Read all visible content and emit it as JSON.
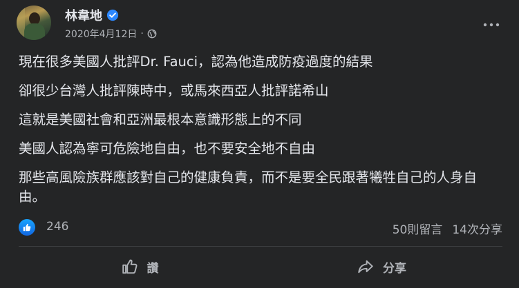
{
  "post": {
    "author": "林韋地",
    "date": "2020年4月12日",
    "separator": "·",
    "paragraphs": [
      "現在很多美國人批評Dr. Fauci，認為他造成防疫過度的結果",
      "卻很少台灣人批評陳時中，或馬來西亞人批評諾希山",
      "這就是美國社會和亞洲最根本意識形態上的不同",
      "美國人認為寧可危險地自由，也不要安全地不自由",
      "那些高風險族群應該對自己的健康負責，而不是要全民跟著犧牲自己的人身自由。"
    ]
  },
  "stats": {
    "likes": "246",
    "comments": "50則留言",
    "shares": "14次分享"
  },
  "actions": {
    "like_label": "讚",
    "share_label": "分享"
  },
  "colors": {
    "background": "#242526",
    "text": "#e4e6eb",
    "secondary": "#b0b3b8",
    "accent": "#2d88ff"
  }
}
